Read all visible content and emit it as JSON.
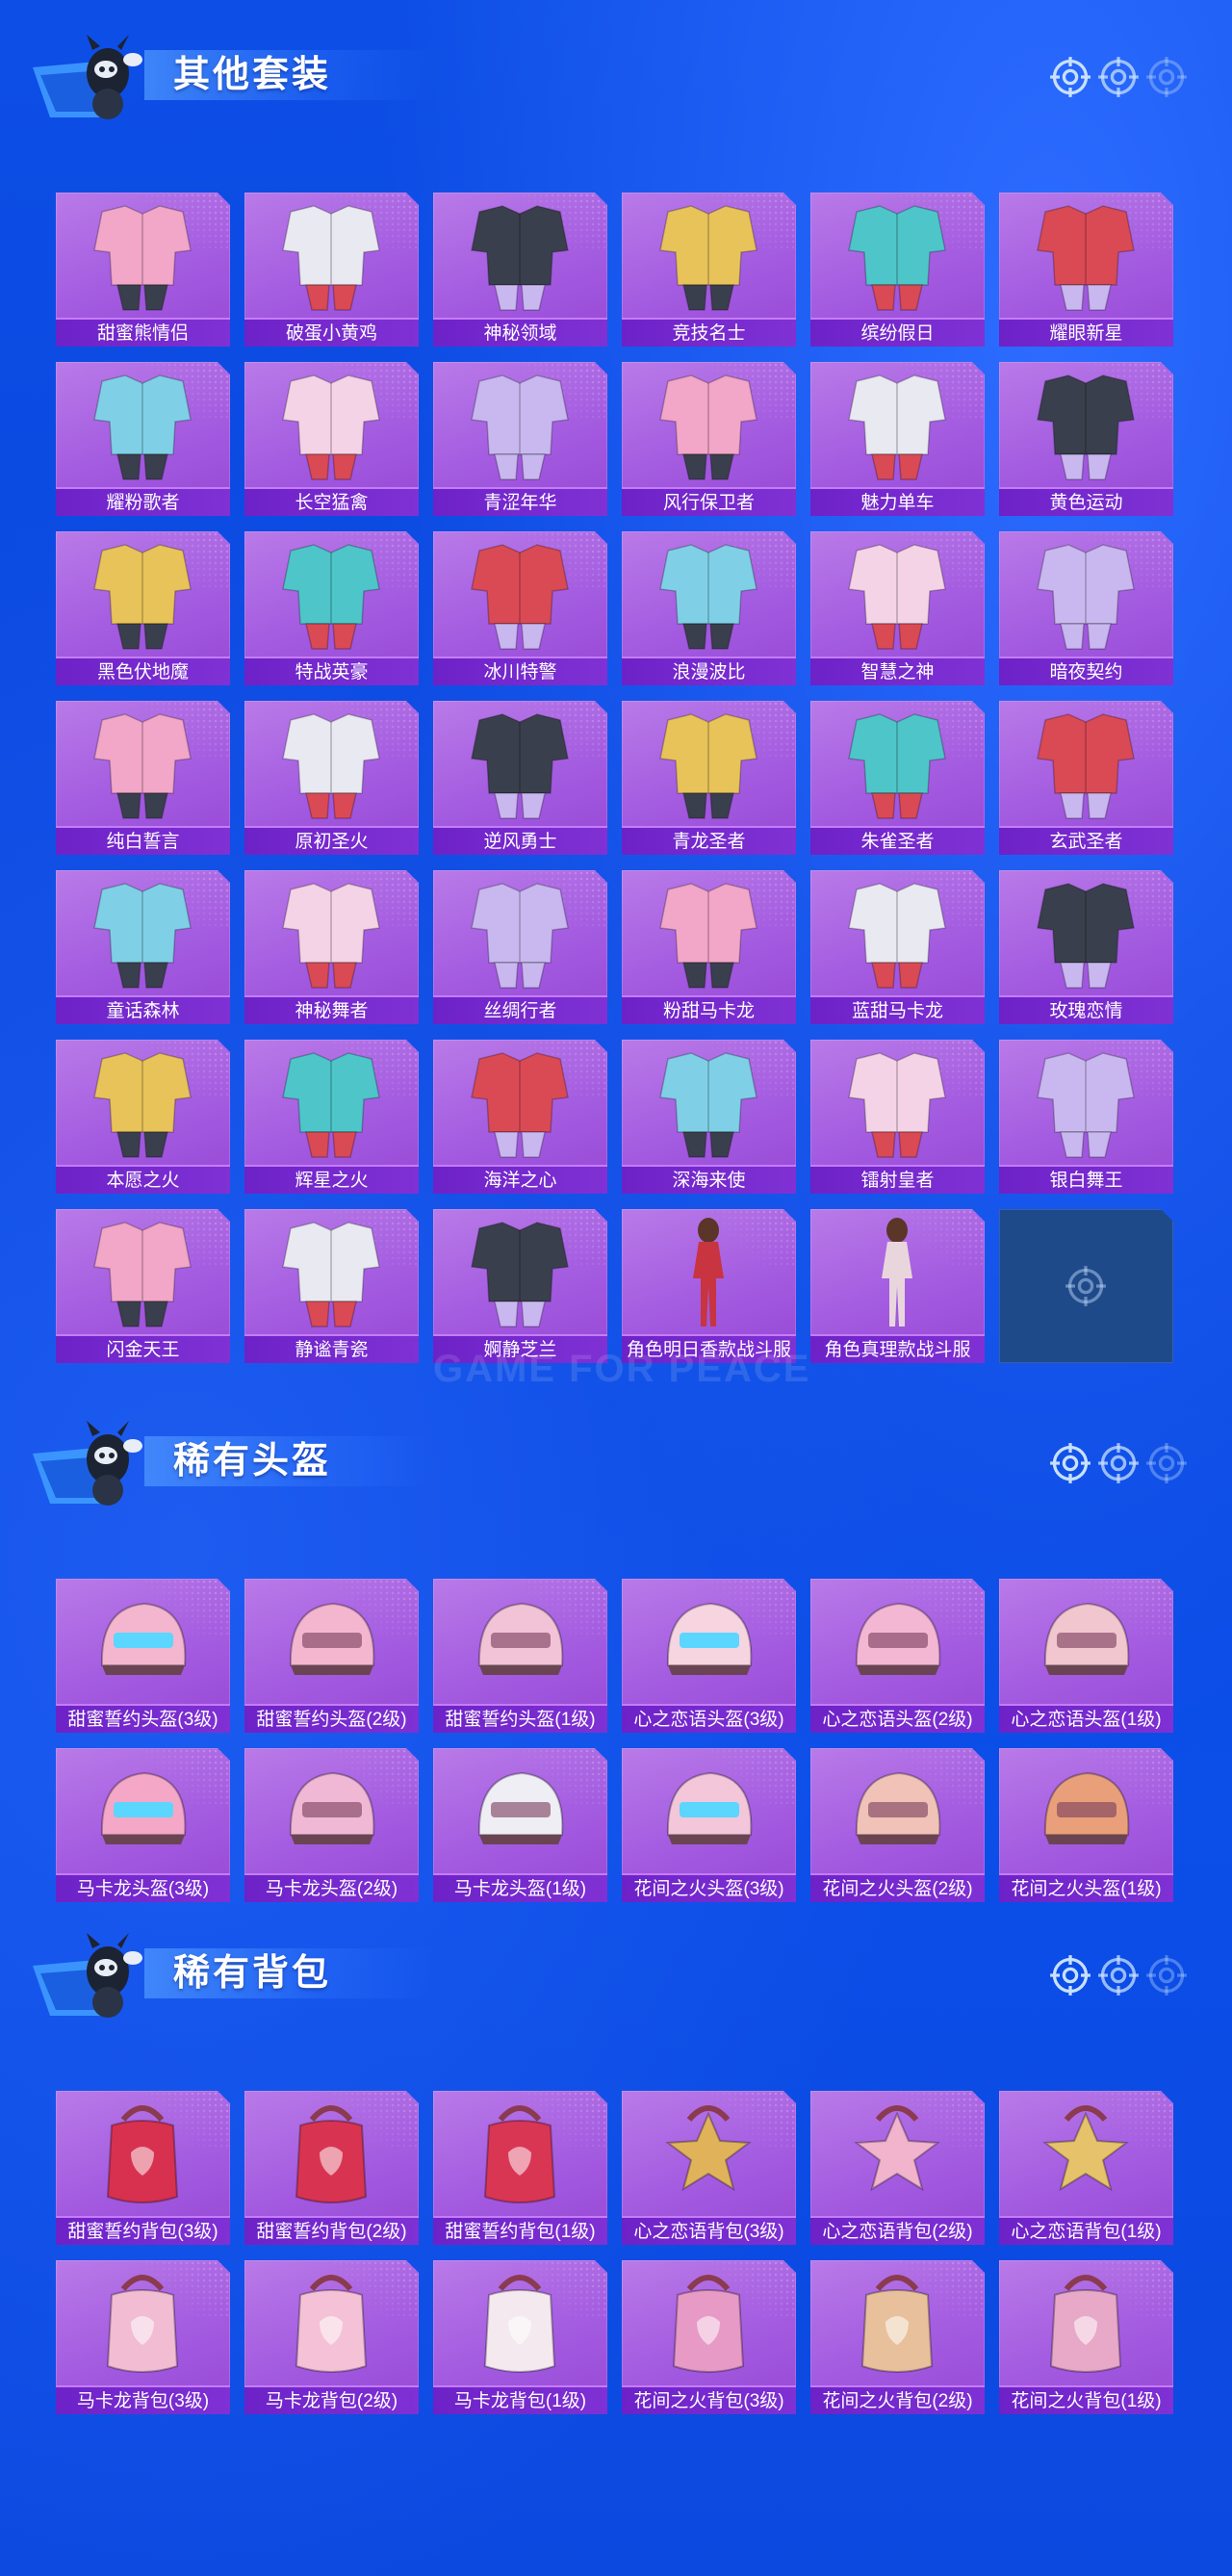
{
  "colors": {
    "background": "#0c4ee6",
    "card": "#a35be0",
    "label_bar": "#7127cc",
    "empty_slot": "#1f4a8a"
  },
  "watermark": "GAME FOR PEACE",
  "sections": [
    {
      "title": "其他套装",
      "kind": "outfit",
      "items": [
        "甜蜜熊情侣",
        "破蛋小黄鸡",
        "神秘领域",
        "竞技名士",
        "缤纷假日",
        "耀眼新星",
        "耀粉歌者",
        "长空猛禽",
        "青涩年华",
        "风行保卫者",
        "魅力单车",
        "黄色运动",
        "黑色伏地魔",
        "特战英豪",
        "冰川特警",
        "浪漫波比",
        "智慧之神",
        "暗夜契约",
        "纯白誓言",
        "原初圣火",
        "逆风勇士",
        "青龙圣者",
        "朱雀圣者",
        "玄武圣者",
        "童话森林",
        "神秘舞者",
        "丝绸行者",
        "粉甜马卡龙",
        "蓝甜马卡龙",
        "玫瑰恋情",
        "本愿之火",
        "辉星之火",
        "海洋之心",
        "深海来使",
        "镭射皇者",
        "银白舞王",
        "闪金天王",
        "静谧青瓷",
        "婀静芝兰",
        "角色明日香款战斗服",
        "角色真理款战斗服"
      ],
      "empty_slot_icon": "target-icon"
    },
    {
      "title": "稀有头盔",
      "kind": "helmet",
      "items": [
        "甜蜜誓约头盔(3级)",
        "甜蜜誓约头盔(2级)",
        "甜蜜誓约头盔(1级)",
        "心之恋语头盔(3级)",
        "心之恋语头盔(2级)",
        "心之恋语头盔(1级)",
        "马卡龙头盔(3级)",
        "马卡龙头盔(2级)",
        "马卡龙头盔(1级)",
        "花间之火头盔(3级)",
        "花间之火头盔(2级)",
        "花间之火头盔(1级)"
      ]
    },
    {
      "title": "稀有背包",
      "kind": "backpack",
      "items": [
        "甜蜜誓约背包(3级)",
        "甜蜜誓约背包(2级)",
        "甜蜜誓约背包(1级)",
        "心之恋语背包(3级)",
        "心之恋语背包(2级)",
        "心之恋语背包(1级)",
        "马卡龙背包(3级)",
        "马卡龙背包(2级)",
        "马卡龙背包(1级)",
        "花间之火背包(3级)",
        "花间之火背包(2级)",
        "花间之火背包(1级)"
      ]
    }
  ],
  "icons": {
    "mascot": "mascot-icon",
    "target": "crosshair-target-icon"
  }
}
